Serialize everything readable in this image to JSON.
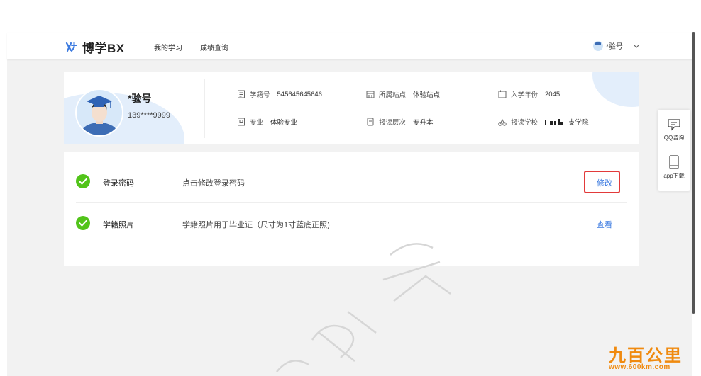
{
  "app": {
    "logo_text": "博学BX",
    "brand_color": "#3d7be0"
  },
  "nav": {
    "items": [
      {
        "label": "我的学习"
      },
      {
        "label": "成绩查询"
      }
    ]
  },
  "user_menu": {
    "name": "*验号"
  },
  "profile": {
    "name": "*验号",
    "phone": "139****9999",
    "student_id_label": "学籍号",
    "student_id": "545645645646",
    "site_label": "所属站点",
    "site": "体验站点",
    "year_label": "入学年份",
    "year": "2045",
    "major_label": "专业",
    "major": "体验专业",
    "level_label": "报读层次",
    "level": "专升本",
    "school_label": "报读学校",
    "school": "支学院"
  },
  "security": {
    "rows": [
      {
        "title": "登录密码",
        "desc": "点击修改登录密码",
        "action": "修改"
      },
      {
        "title": "学籍照片",
        "desc": "学籍照片用于毕业证（尺寸为1寸蓝底正照)",
        "action": "查看"
      }
    ],
    "status_color": "#52c41a",
    "highlight_color": "#e23a3a"
  },
  "side_panel": {
    "qq_label": "QQ咨询",
    "app_label": "app下载"
  },
  "watermarks": {
    "brand_big": "九百公里",
    "brand_url": "www.600km.com"
  }
}
